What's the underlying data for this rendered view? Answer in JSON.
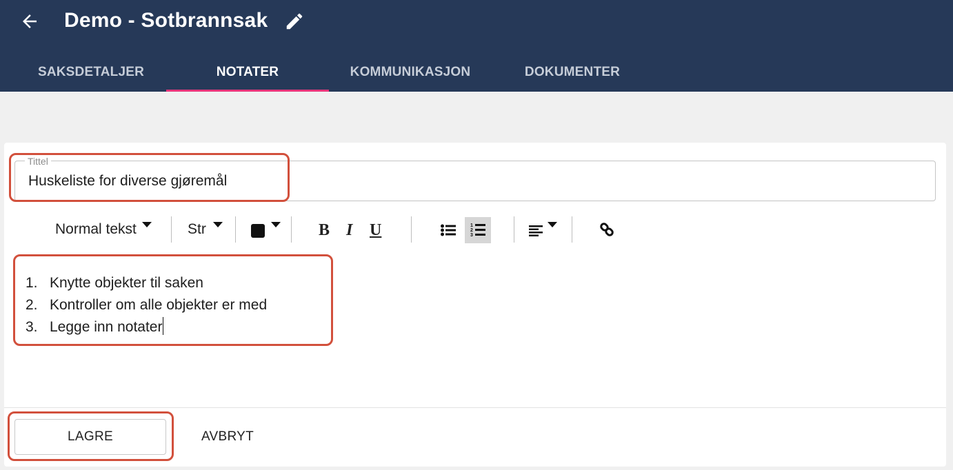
{
  "header": {
    "title": "Demo - Sotbrannsak",
    "back_icon": "arrow-left-icon",
    "edit_icon": "pencil-icon"
  },
  "tabs": [
    {
      "label": "SAKSDETALJER",
      "active": false
    },
    {
      "label": "NOTATER",
      "active": true
    },
    {
      "label": "KOMMUNIKASJON",
      "active": false
    },
    {
      "label": "DOKUMENTER",
      "active": false
    }
  ],
  "form": {
    "title_label": "Tittel",
    "title_value": "Huskeliste for diverse gjøremål"
  },
  "toolbar": {
    "format_label": "Normal tekst",
    "size_label": "Str",
    "bold_label": "B",
    "italic_label": "I",
    "underline_label": "U",
    "icons": [
      "text-color-icon",
      "bullet-list-icon",
      "numbered-list-icon",
      "align-icon",
      "link-icon"
    ]
  },
  "editor": {
    "list_type": "numbered",
    "items": [
      {
        "num": "1.",
        "text": "Knytte objekter til saken"
      },
      {
        "num": "2.",
        "text": "Kontroller om alle objekter er med"
      },
      {
        "num": "3.",
        "text": "Legge inn notater"
      }
    ]
  },
  "actions": {
    "save_label": "LAGRE",
    "cancel_label": "AVBRYT"
  },
  "colors": {
    "appbar": "#263958",
    "tab_indicator": "#e8357a",
    "highlight": "#d2503c"
  }
}
